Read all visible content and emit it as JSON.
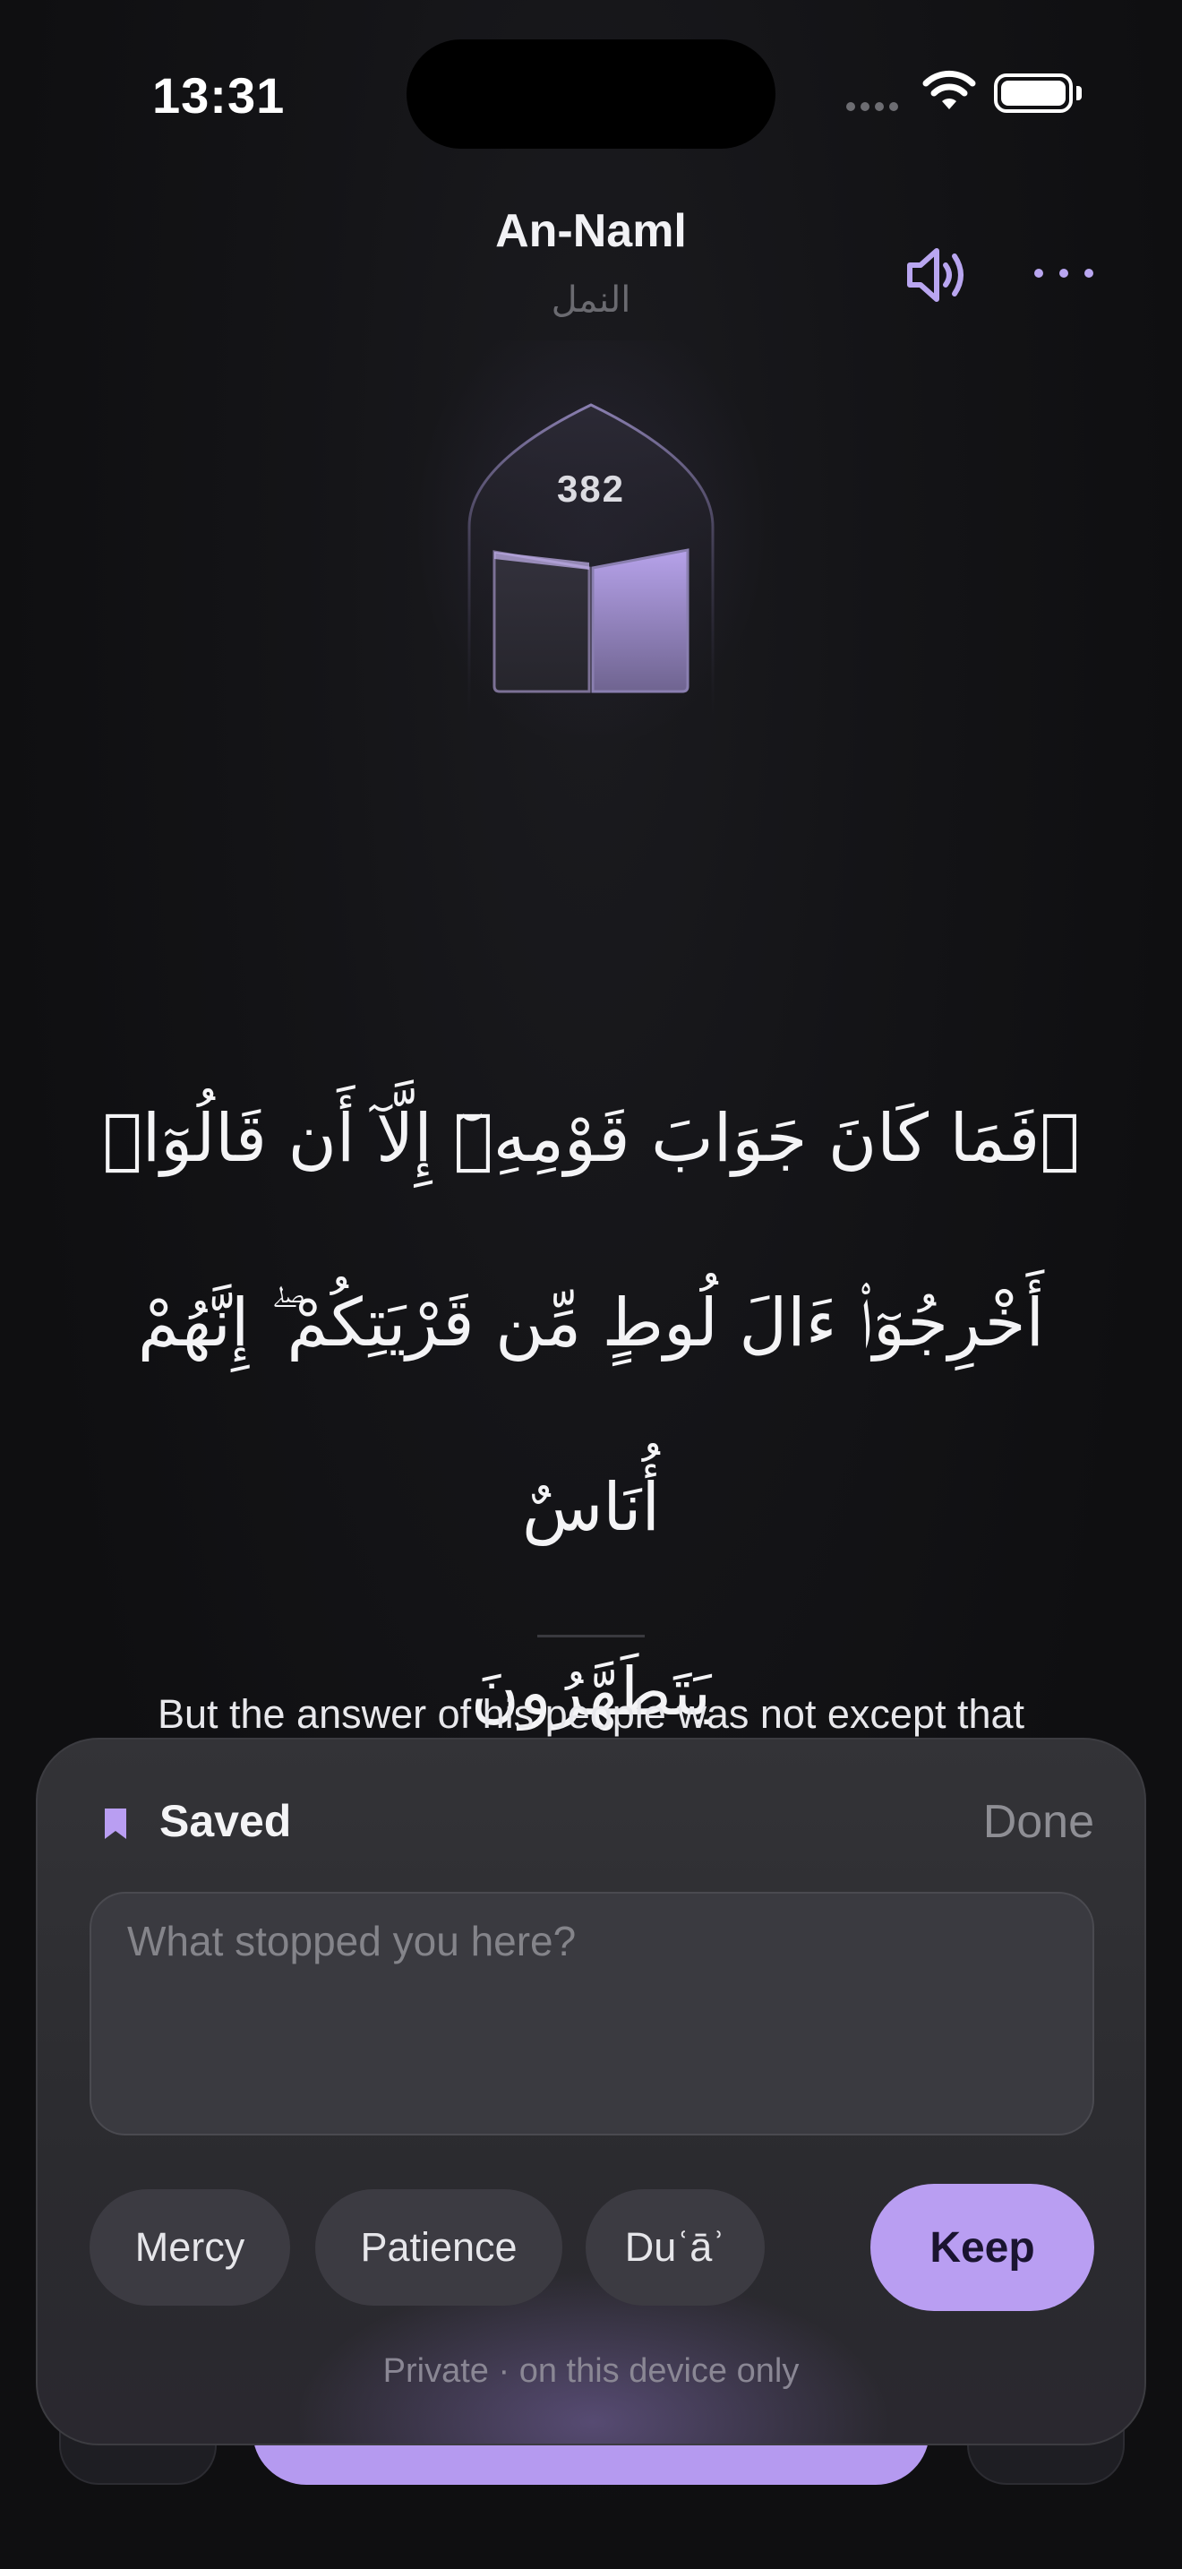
{
  "status_bar": {
    "time": "13:31"
  },
  "header": {
    "surah_name": "An-Naml",
    "surah_name_arabic": "النمل",
    "icons": {
      "audio": "speaker-wave-icon",
      "more": "ellipsis-icon"
    }
  },
  "page": {
    "number": "382"
  },
  "verse": {
    "arabic_lines": [
      "۞فَمَا كَانَ جَوَابَ قَوْمِهِۦٓ إِلَّآ أَن قَالُوٓا۟",
      "أَخْرِجُوٓا۟ ءَالَ لُوطٍ مِّن قَرْيَتِكُمْ ۖ إِنَّهُمْ أُنَاسٌ",
      "يَتَطَهَّرُونَ"
    ],
    "translation": "But the answer of his people was not except that"
  },
  "sheet": {
    "title": "Saved",
    "done_label": "Done",
    "note_placeholder": "What stopped you here?",
    "tags": [
      "Mercy",
      "Patience",
      "Duʿāʾ"
    ],
    "keep_label": "Keep",
    "privacy_note": "Private · on this device only"
  },
  "colors": {
    "accent": "#b99ef2",
    "background": "#101012",
    "sheet": "#2f2f33"
  }
}
